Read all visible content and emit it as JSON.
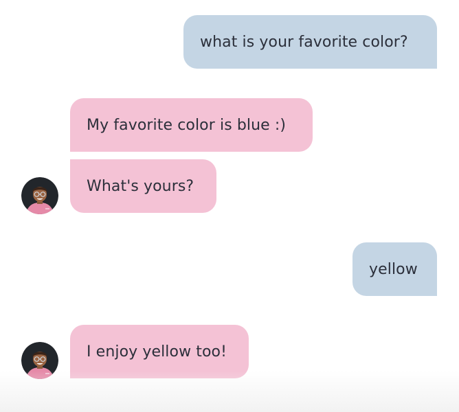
{
  "messages": [
    {
      "sender": "user",
      "text": "what is your favorite color?"
    },
    {
      "sender": "bot",
      "text": "My favorite color is blue :)"
    },
    {
      "sender": "bot",
      "text": "What's yours?"
    },
    {
      "sender": "user",
      "text": "yellow"
    },
    {
      "sender": "bot",
      "text": "I enjoy yellow too!"
    }
  ],
  "colors": {
    "user_bubble": "#c4d5e4",
    "bot_bubble": "#f4c2d5",
    "text": "#2b2f3a"
  },
  "avatar": {
    "icon": "bot-avatar-icon"
  }
}
